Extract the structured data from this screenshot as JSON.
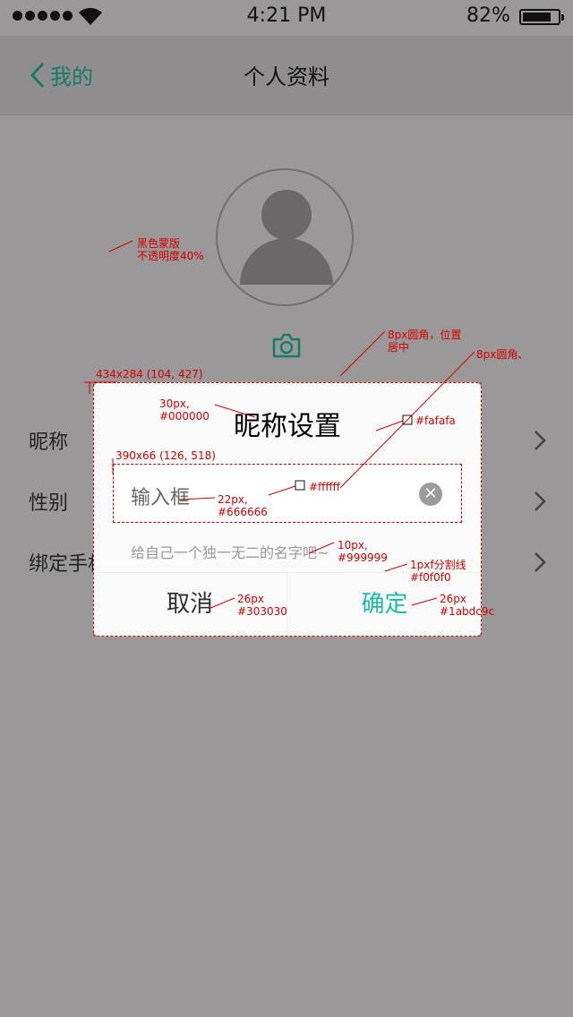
{
  "status_bar": {
    "time": "4:21 PM",
    "battery": "82%",
    "battery_level": 0.82
  },
  "nav": {
    "back_label": "我的",
    "title": "个人资料"
  },
  "list": [
    {
      "label": "昵称"
    },
    {
      "label": "性别"
    },
    {
      "label": "绑定手机"
    }
  ],
  "dialog": {
    "title": "昵称设置",
    "input_placeholder": "输入框",
    "hint": "给自己一个独一无二的名字吧~",
    "cancel_label": "取消",
    "confirm_label": "确定"
  },
  "annotations": {
    "mask": "黑色蒙版\n不透明度40%",
    "dialog_spec": "434x284 (104, 427)",
    "corner_position": "8px圆角，位置\n居中",
    "corner": "8px圆角、",
    "title_font": "30px,\n#000000",
    "bg_color": "#fafafa",
    "input_spec": "390x66 (126, 518)",
    "input_font": "22px,\n#666666",
    "input_bg": "#ffffff",
    "hint_font": "10px,\n#999999",
    "divider": "1pxf分割线\n#f0f0f0",
    "cancel_font": "26px\n#303030",
    "confirm_font": "26px\n#1abdc9c"
  },
  "colors": {
    "accent": "#1abd9c",
    "dialog_bg": "#fafafa",
    "input_bg": "#ffffff",
    "divider": "#f0f0f0"
  }
}
